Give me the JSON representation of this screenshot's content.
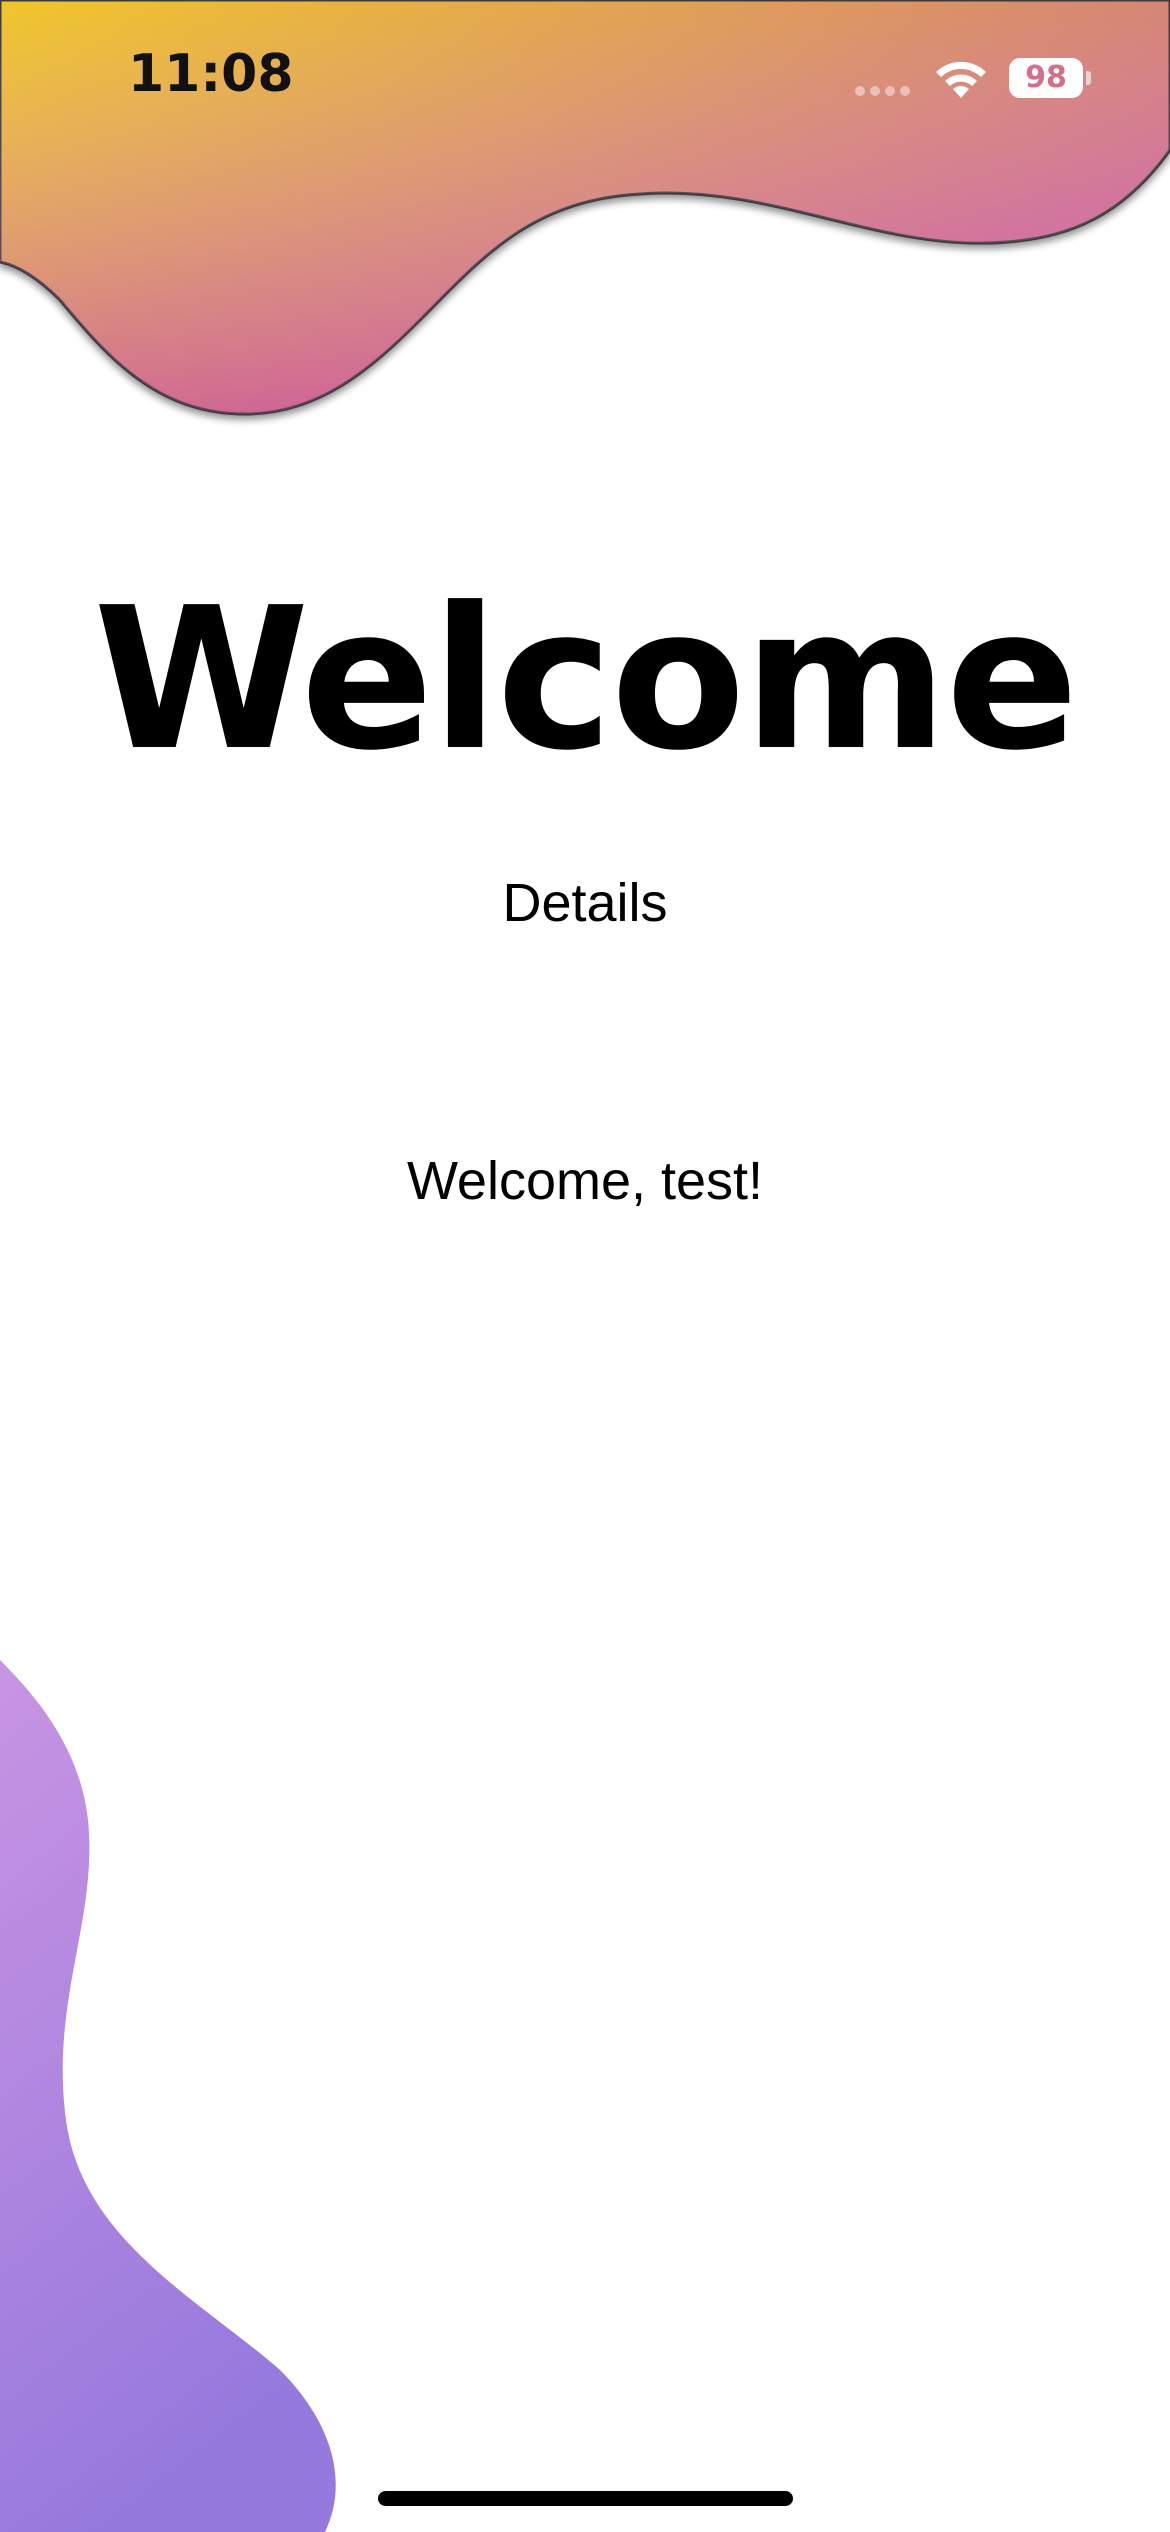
{
  "status_bar": {
    "time": "11:08",
    "battery_level": "98",
    "signal_icon": "cellular-signal-icon",
    "wifi_icon": "wifi-icon",
    "battery_icon": "battery-icon"
  },
  "main": {
    "title": "Welcome",
    "details_label": "Details",
    "welcome_message": "Welcome, test!"
  },
  "theme": {
    "top_wave_gradient": [
      "#f0c62a",
      "#d88c6c",
      "#c84cb8"
    ],
    "bottom_wave_gradient": [
      "#c893e2",
      "#9b7ede"
    ],
    "text_color": "#000000",
    "background": "#ffffff"
  }
}
